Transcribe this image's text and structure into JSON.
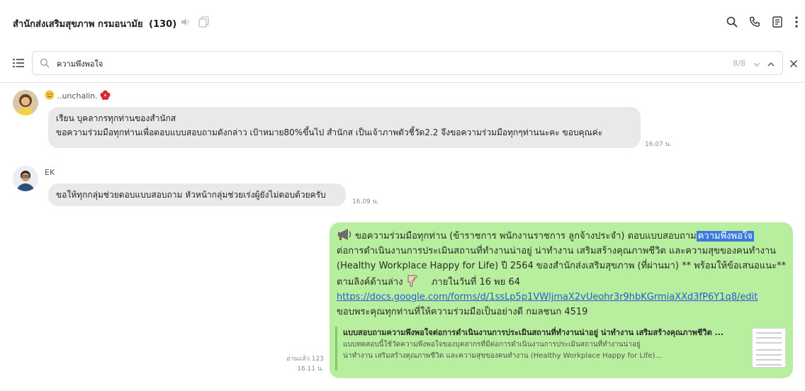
{
  "chat": {
    "title": "สำนักส่งเสริมสุขภาพ กรมอนามัย",
    "member_count": "(130)"
  },
  "search": {
    "query": "ความพึงพอใจ",
    "match_count": "8/8"
  },
  "messages": [
    {
      "sender": "..unchalin.",
      "lines": [
        "เรียน บุคลากรทุกท่านของสำนักส",
        "ขอความร่วมมือทุกท่านเพื่อตอบแบบสอบถามดังกล่าว เป้าหมาย80%ขึ้นไป  สำนักส เป็นเจ้าภาพตัวชี้วัด2.2 จึงขอความร่วมมือทุกๆท่านนะคะ  ขอบคุณค่ะ"
      ],
      "time": "16.07 น."
    },
    {
      "sender": "EK",
      "lines": [
        "ขอให้ทุกกลุ่มช่วยตอบแบบสอบถาม หัวหน้ากลุ่มช่วยเร่งผู้ยังไม่ตอบด้วยครับ"
      ],
      "time": "16.09 น."
    }
  ],
  "outgoing": {
    "line1_pre": "ขอความร่วมมือทุกท่าน (ข้าราชการ พนักงานราชการ ลูกจ้างประจำ) ตอบแบบสอบถาม",
    "line1_highlight": "ความพึงพอใจ",
    "line2": "ต่อการดำเนินงานการประเมินสถานที่ทำงานน่าอยู่ น่าทำงาน เสริมสร้างคุณภาพชีวิต และความสุขของคนทำงาน",
    "line3": "(Healthy Workplace Happy for Life)   ปี 2564  ของสำนักส่งเสริมสุขภาพ (ที่ผ่านมา)  ** พร้อมให้ข้อเสนอแนะ**",
    "line4_pre": "ตามลิงค์ด้านล่าง",
    "line4_post": "ภายในวันที่ 16 พย 64",
    "link": "https://docs.google.com/forms/d/1ssLp5p1VWljmaX2vUeohr3r9hbKGrmiaXXd3fP6Y1q8/edit",
    "line6": "ขอบพระคุณทุกท่านที่ให้ความร่วมมือเป็นอย่างดี     กมลชนก 4519",
    "preview_title": "แบบสอบถามความพึงพอใจต่อการดำเนินงานการประเมินสถานที่ทำงานน่าอยู่ น่าทำงาน เสริมสร้างคุณภาพชีวิต ...",
    "preview_desc1": "แบบทดสอบนี้ใช้วัดความพึงพอใจของบุคลากรที่มีต่อการดำเนินงานการประเมินสถานที่ทำงานน่าอยู่",
    "preview_desc2": "น่าทำงาน เสริมสร้างคุณภาพชีวิต และความสุขของคนทำงาน (Healthy Workplace Happy for Life)...",
    "read_status": "อ่านแล้ว 123",
    "time": "16.11 น."
  },
  "icons": {
    "header": [
      "mute-icon",
      "copy-icon",
      "search-icon",
      "phone-icon",
      "notes-icon",
      "more-icon"
    ],
    "search_bar": [
      "list-icon",
      "search-icon",
      "chevron-down-icon",
      "chevron-up-icon",
      "close-icon"
    ]
  },
  "colors": {
    "outgoing_bubble": "#b8ef9e",
    "incoming_bubble": "#e9e9e9",
    "highlight": "#3b79e0",
    "link": "#2a5bd7"
  }
}
